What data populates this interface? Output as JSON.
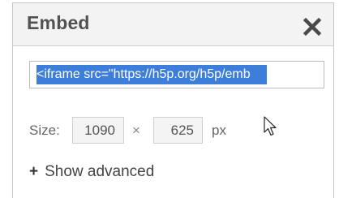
{
  "dialog": {
    "title": "Embed",
    "close_icon": "close-icon",
    "embed_code_selected_text": "<iframe src=\"https://h5p.org/h5p/emb",
    "size": {
      "label": "Size:",
      "width_value": "1090",
      "times_symbol": "×",
      "height_value": "625",
      "unit": "px"
    },
    "show_advanced": {
      "icon_text": "+",
      "label": "Show advanced"
    }
  },
  "colors": {
    "selection": "#3d7edb",
    "titlebar": "#f3f3f3",
    "border": "#c7c7c7"
  },
  "icons": [
    "close-icon",
    "mouse-pointer-icon"
  ]
}
